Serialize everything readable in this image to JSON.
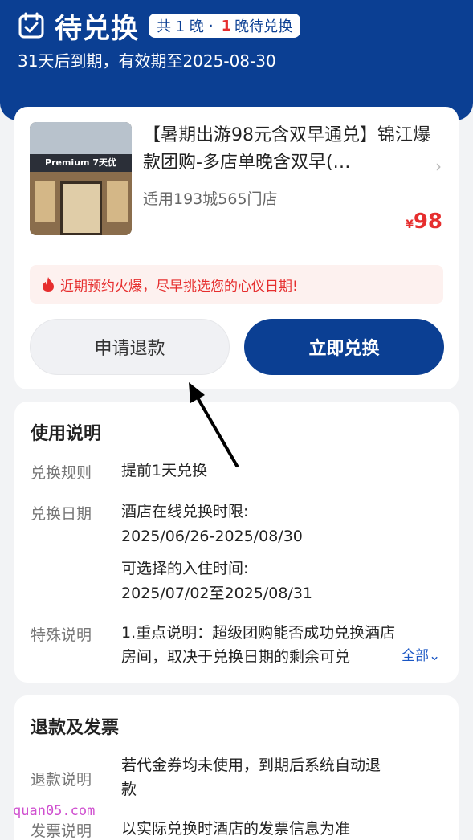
{
  "header": {
    "icon": "calendar-check-icon",
    "title": "待兑换",
    "pill": {
      "prefix": "共 1 晚",
      "sep": "·",
      "count": "1",
      "suffix": "晚待兑换"
    },
    "subtitle": "31天后到期，有效期至2025-08-30"
  },
  "deal": {
    "title": "【暑期出游98元含双早通兑】锦江爆款团购-多店单晚含双早(…",
    "image_sign": "Premium 7天优",
    "stores": "适用193城565门店",
    "currency": "¥",
    "price": "98",
    "tip": "近期预约火爆，尽早挑选您的心仪日期!",
    "refund_button": "申请退款",
    "redeem_button": "立即兑换"
  },
  "usage": {
    "title": "使用说明",
    "rule_label": "兑换规则",
    "rule_value": "提前1天兑换",
    "date_label": "兑换日期",
    "date_lines": [
      "酒店在线兑换时限:",
      "2025/06/26-2025/08/30",
      "可选择的入住时间:",
      "2025/07/02至2025/08/31"
    ],
    "special_label": "特殊说明",
    "special_lines": [
      "1.重点说明：超级团购能否成功兑换酒店",
      "房间，取决于兑换日期的剩余可兑"
    ],
    "more": "全部⌄"
  },
  "refund": {
    "title": "退款及发票",
    "refund_label": "退款说明",
    "refund_lines": [
      "若代金券均未使用，到期后系统自动退",
      "款"
    ],
    "invoice_label": "发票说明",
    "invoice_value": "以实际兑换时酒店的发票信息为准"
  },
  "watermark": "quan05.com",
  "colors": {
    "brand": "#0b3f93",
    "price": "#e62e2e",
    "link": "#1a56c4",
    "background": "#f2f3f5"
  }
}
